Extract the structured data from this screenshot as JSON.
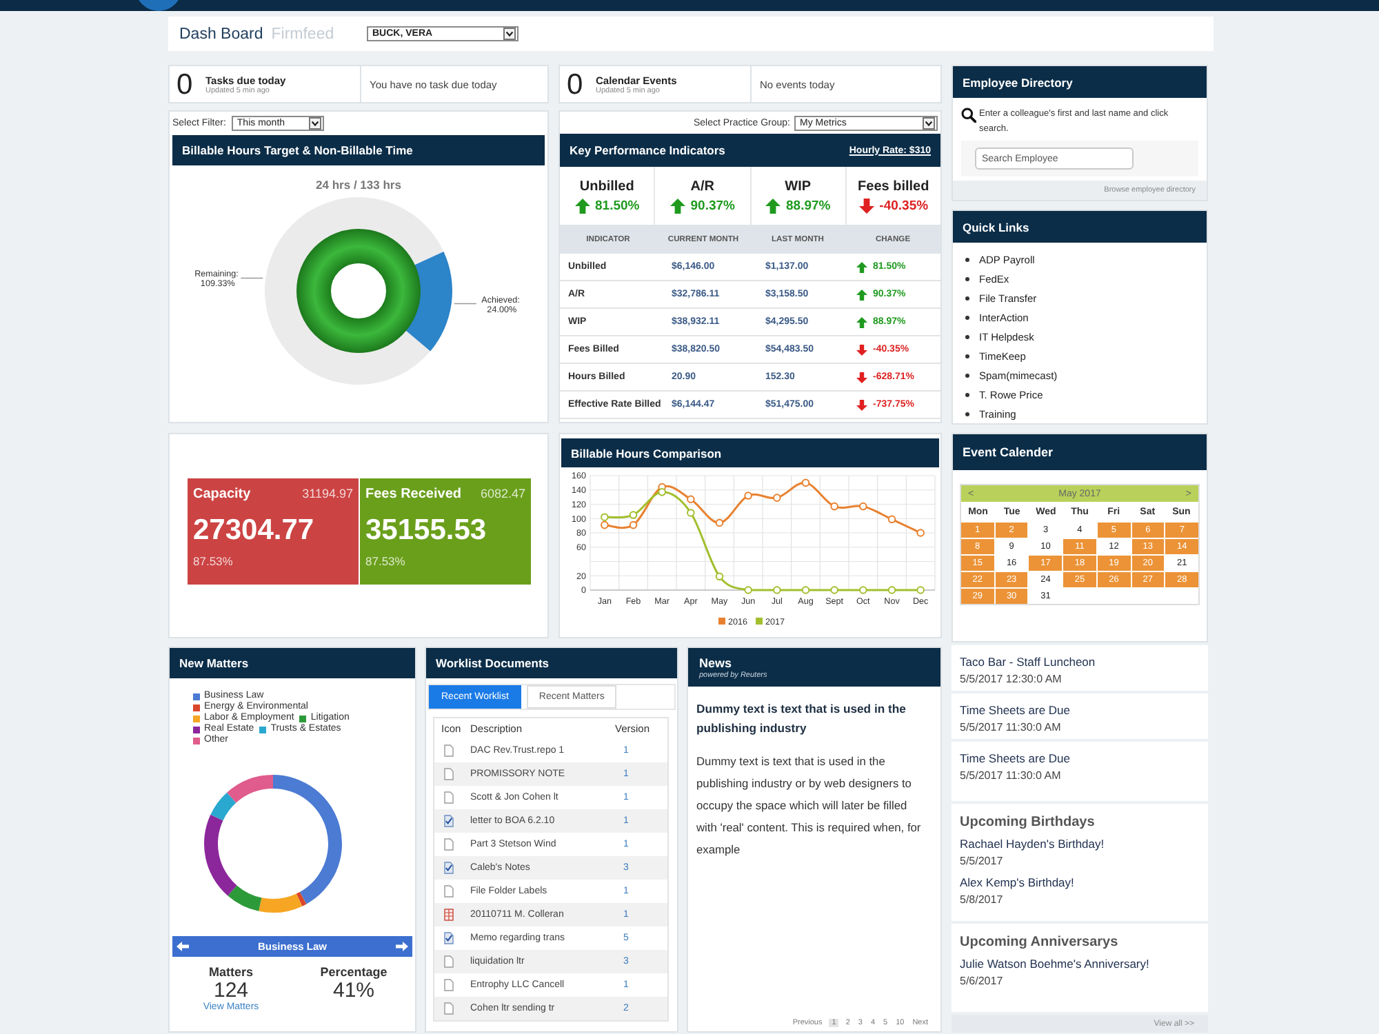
{
  "nav": {
    "tabs": [
      {
        "label": "Dash Board",
        "selected": true
      },
      {
        "label": "Firmfeed",
        "selected": false
      }
    ],
    "user_select": {
      "value": "BUCK, VERA"
    }
  },
  "tasks": {
    "count": "0",
    "title": "Tasks due today",
    "updated": "Updated 5 min ago",
    "message": "You have no task due today"
  },
  "calendar_events": {
    "count": "0",
    "title": "Calendar Events",
    "updated": "Updated 5 min ago",
    "message": "No events today"
  },
  "employee_directory": {
    "title": "Employee Directory",
    "hint": "Enter a colleague's first and last name and click search.",
    "search": {
      "placeholder": "Search Employee"
    },
    "browse_link": "Browse employee directory"
  },
  "billable_hours": {
    "filter_label": "Select Filter:",
    "filter_value": "This month",
    "title": "Billable Hours Target & Non-Billable Time",
    "label_separator": ":",
    "chart_data": [
      {
        "type": "donut",
        "title": "24 hrs / 133 hrs",
        "categories": [
          "Remaining",
          "Achieved"
        ],
        "values": [
          109.33,
          24.0
        ],
        "colors": [
          "#ebebeb",
          "#2c84c9"
        ],
        "value_labels": [
          "109.33%",
          "24.00%"
        ]
      }
    ]
  },
  "kpi": {
    "group_label": "Select Practice Group:",
    "group_value": "My Metrics",
    "title": "Key Performance Indicators",
    "hourly_rate": "Hourly Rate: $310",
    "summary": [
      {
        "label": "Unbilled",
        "kind": "up",
        "value": "81.50%"
      },
      {
        "label": "A/R",
        "kind": "up",
        "value": "90.37%"
      },
      {
        "label": "WIP",
        "kind": "up",
        "value": "88.97%"
      },
      {
        "label": "Fees billed",
        "kind": "down",
        "value": "-40.35%"
      }
    ],
    "columns": [
      "INDICATOR",
      "CURRENT MONTH",
      "LAST MONTH",
      "CHANGE"
    ],
    "rows": [
      {
        "indicator": "Unbilled",
        "current": "$6,146.00",
        "last": "$1,137.00",
        "kind": "up",
        "change": "81.50%"
      },
      {
        "indicator": "A/R",
        "current": "$32,786.11",
        "last": "$3,158.50",
        "kind": "up",
        "change": "90.37%"
      },
      {
        "indicator": "WIP",
        "current": "$38,932.11",
        "last": "$4,295.50",
        "kind": "up",
        "change": "88.97%"
      },
      {
        "indicator": "Fees Billed",
        "current": "$38,820.50",
        "last": "$54,483.50",
        "kind": "down",
        "change": "-40.35%"
      },
      {
        "indicator": "Hours Billed",
        "current": "20.90",
        "last": "152.30",
        "kind": "down",
        "change": "-628.71%"
      },
      {
        "indicator": "Effective Rate Billed",
        "current": "$6,144.47",
        "last": "$51,475.00",
        "kind": "down",
        "change": "-737.75%"
      }
    ]
  },
  "quick_links": {
    "title": "Quick Links",
    "items": [
      "ADP Payroll",
      "FedEx",
      "File Transfer",
      "InterAction",
      "IT Helpdesk",
      "TimeKeep",
      "Spam(mimecast)",
      "T. Rowe Price",
      "Training"
    ]
  },
  "capacity": {
    "tiles": [
      {
        "label": "Capacity",
        "secondary": "31194.97",
        "value": "27304.77",
        "percent": "87.53%",
        "color": "#cc4343"
      },
      {
        "label": "Fees Received",
        "secondary": "6082.47",
        "value": "35155.53",
        "percent": "87.53%",
        "color": "#6a9f1b"
      }
    ]
  },
  "billable_comparison": {
    "title": "Billable Hours Comparison",
    "chart_data": [
      {
        "type": "line",
        "categories": [
          "Jan",
          "Feb",
          "Mar",
          "Apr",
          "May",
          "Jun",
          "Jul",
          "Aug",
          "Sept",
          "Oct",
          "Nov",
          "Dec"
        ],
        "ylim": [
          0,
          160
        ],
        "yticks": [
          0,
          20,
          60,
          80,
          100,
          120,
          140,
          160
        ],
        "grid": true,
        "marker": "circle",
        "legend": "bottom",
        "series": [
          {
            "name": "2016",
            "color": "#e8812f",
            "values": [
              91,
              91,
              144,
              127,
              94,
              132,
              129,
              150,
              117,
              117,
              99,
              80
            ]
          },
          {
            "name": "2017",
            "color": "#a2bf2e",
            "values": [
              102,
              105,
              137,
              108,
              19,
              0,
              0,
              0,
              0,
              0,
              0,
              0
            ]
          }
        ]
      }
    ]
  },
  "event_calendar": {
    "title": "Event Calender",
    "calendar": {
      "prev": "<",
      "month": "May 2017",
      "next": ">",
      "weekdays": [
        "Mon",
        "Tue",
        "Wed",
        "Thu",
        "Fri",
        "Sat",
        "Sun"
      ],
      "days": [
        {
          "label": "1",
          "has_event": true
        },
        {
          "label": "2",
          "has_event": true
        },
        {
          "label": "3",
          "has_event": false
        },
        {
          "label": "4",
          "has_event": false
        },
        {
          "label": "5",
          "has_event": true
        },
        {
          "label": "6",
          "has_event": true
        },
        {
          "label": "7",
          "has_event": true
        },
        {
          "label": "8",
          "has_event": true
        },
        {
          "label": "9",
          "has_event": false
        },
        {
          "label": "10",
          "has_event": false
        },
        {
          "label": "11",
          "has_event": true
        },
        {
          "label": "12",
          "has_event": false
        },
        {
          "label": "13",
          "has_event": true
        },
        {
          "label": "14",
          "has_event": true
        },
        {
          "label": "15",
          "has_event": true
        },
        {
          "label": "16",
          "has_event": false
        },
        {
          "label": "17",
          "has_event": true
        },
        {
          "label": "18",
          "has_event": true
        },
        {
          "label": "19",
          "has_event": true
        },
        {
          "label": "20",
          "has_event": true
        },
        {
          "label": "21",
          "has_event": false
        },
        {
          "label": "22",
          "has_event": true
        },
        {
          "label": "23",
          "has_event": true
        },
        {
          "label": "24",
          "has_event": false
        },
        {
          "label": "25",
          "has_event": true
        },
        {
          "label": "26",
          "has_event": true
        },
        {
          "label": "27",
          "has_event": true
        },
        {
          "label": "28",
          "has_event": true
        },
        {
          "label": "29",
          "has_event": true
        },
        {
          "label": "30",
          "has_event": true
        },
        {
          "label": "31",
          "has_event": false
        }
      ]
    },
    "events": [
      {
        "title": "Taco Bar - Staff Luncheon",
        "date": "5/5/2017 12:30:0 AM"
      },
      {
        "title": "Time Sheets are Due",
        "date": "5/5/2017 11:30:0 AM"
      },
      {
        "title": "Time Sheets are Due",
        "date": "5/5/2017 11:30:0 AM"
      }
    ],
    "birthdays": {
      "title": "Upcoming Birthdays",
      "items": [
        {
          "title": "Rachael Hayden's Birthday!",
          "date": "5/5/2017"
        },
        {
          "title": "Alex Kemp's Birthday!",
          "date": "5/8/2017"
        }
      ]
    },
    "anniversaries": {
      "title": "Upcoming Anniversarys",
      "items": [
        {
          "title": "Julie Watson Boehme's Anniversary!",
          "date": "5/6/2017"
        }
      ]
    },
    "view_all": "View all >>"
  },
  "new_matters": {
    "title": "New Matters",
    "legend": [
      {
        "label": "Business Law",
        "color": "#4b7bd3"
      },
      {
        "label": "Energy & Environmental",
        "color": "#d9472b"
      },
      {
        "label": "Labor & Employment",
        "color": "#f6a623"
      },
      {
        "label": "Litigation",
        "color": "#2d9a3a"
      },
      {
        "label": "Real Estate",
        "color": "#8c279b"
      },
      {
        "label": "Trusts & Estates",
        "color": "#2aa8cf"
      },
      {
        "label": "Other",
        "color": "#e05c8c"
      }
    ],
    "selected_category": "Business Law",
    "stats": [
      {
        "label": "Matters",
        "value": "124"
      },
      {
        "label": "Percentage",
        "value": "41%"
      }
    ],
    "link": "View Matters"
  },
  "worklist": {
    "title": "Worklist Documents",
    "tabs": [
      {
        "label": "Recent Worklist",
        "selected": true
      },
      {
        "label": "Recent Matters",
        "selected": false
      }
    ],
    "columns": [
      "Icon",
      "Description",
      "Version"
    ],
    "rows": [
      {
        "kind": "document",
        "description": "DAC Rev.Trust.repo 1",
        "version": "1"
      },
      {
        "kind": "document",
        "description": "PROMISSORY NOTE",
        "version": "1"
      },
      {
        "kind": "document",
        "description": "Scott & Jon Cohen lt",
        "version": "1"
      },
      {
        "kind": "checked_document",
        "description": "letter to BOA 6.2.10",
        "version": "1"
      },
      {
        "kind": "document",
        "description": "Part 3 Stetson Wind",
        "version": "1"
      },
      {
        "kind": "checked_document",
        "description": "Caleb's Notes",
        "version": "3"
      },
      {
        "kind": "document",
        "description": "File Folder Labels",
        "version": "1"
      },
      {
        "kind": "spreadsheet",
        "description": "20110711 M. Colleran",
        "version": "1"
      },
      {
        "kind": "checked_document",
        "description": "Memo regarding trans",
        "version": "5"
      },
      {
        "kind": "document",
        "description": "liquidation ltr",
        "version": "3"
      },
      {
        "kind": "document",
        "description": "Entrophy LLC Cancell",
        "version": "1"
      },
      {
        "kind": "document",
        "description": "Cohen ltr sending tr",
        "version": "2"
      }
    ]
  },
  "news": {
    "title": "News",
    "subtitle": "powered by Reuters",
    "headline": "Dummy text is text that is used in the publishing industry",
    "body": "Dummy text is text that is used in the publishing industry or by web designers to occupy the space which will later be filled with 'real' content. This is required when, for example",
    "pages": [
      {
        "label": "Previous",
        "selected": false
      },
      {
        "label": "1",
        "selected": true
      },
      {
        "label": "2",
        "selected": false
      },
      {
        "label": "3",
        "selected": false
      },
      {
        "label": "4",
        "selected": false
      },
      {
        "label": "5",
        "selected": false
      },
      {
        "label": "10",
        "selected": false
      },
      {
        "label": "Next",
        "selected": false
      }
    ]
  }
}
